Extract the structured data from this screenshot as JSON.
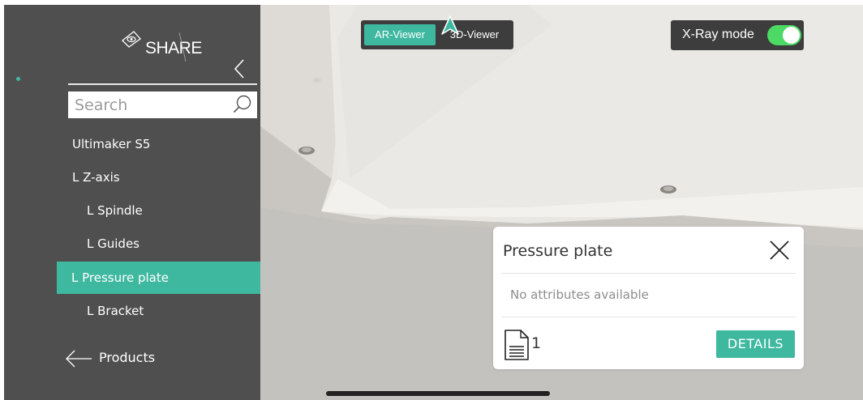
{
  "brand": {
    "logo_text": "SHARE"
  },
  "search": {
    "placeholder": "Search"
  },
  "tree": {
    "items": [
      {
        "label": "Ultimaker S5"
      },
      {
        "label": "L Z-axis"
      },
      {
        "label": "L Spindle"
      },
      {
        "label": "L Guides"
      },
      {
        "label": "L Pressure plate",
        "selected": true
      },
      {
        "label": "L Bracket"
      }
    ]
  },
  "footer": {
    "products_label": "Products"
  },
  "viewer_toggle": {
    "ar_label": "AR-Viewer",
    "td_label": "3D-Viewer",
    "active": "AR-Viewer"
  },
  "xray": {
    "label": "X-Ray mode",
    "enabled": true
  },
  "detail_card": {
    "title": "Pressure plate",
    "attributes_text": "No attributes available",
    "document_count": "1",
    "details_label": "DETAILS"
  },
  "colors": {
    "accent": "#3fb8a0",
    "sidebar_bg": "#4f4f4f",
    "toggle_on": "#4cd964"
  }
}
